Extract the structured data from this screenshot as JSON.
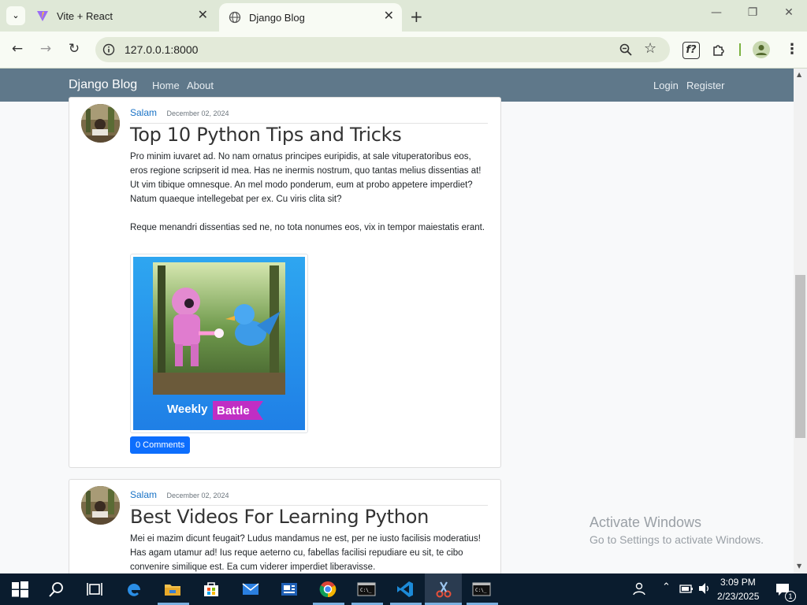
{
  "browser": {
    "tabs": [
      {
        "title": "Vite + React"
      },
      {
        "title": "Django Blog"
      }
    ],
    "url": "127.0.0.1:8000"
  },
  "navbar": {
    "brand": "Django Blog",
    "links": [
      "Home",
      "About"
    ],
    "right_links": [
      "Login",
      "Register"
    ]
  },
  "posts": [
    {
      "author": "Salam",
      "date": "December 02, 2024",
      "title": "Top 10 Python Tips and Tricks",
      "paragraphs": [
        "Pro minim iuvaret ad. No nam ornatus principes euripidis, at sale vituperatoribus eos, eros regione scripserit id mea. Has ne inermis nostrum, quo tantas melius dissentias at! Ut vim tibique omnesque. An mel modo ponderum, eum at probo appetere imperdiet? Natum quaeque intellegebat per ex. Cu viris clita sit?",
        "Reque menandri dissentias sed ne, no tota nonumes eos, vix in tempor maiestatis erant."
      ],
      "image_caption": [
        "Weekly",
        "Battle"
      ],
      "comments_label": "0 Comments"
    },
    {
      "author": "Salam",
      "date": "December 02, 2024",
      "title": "Best Videos For Learning Python",
      "paragraphs": [
        "Mei ei mazim dicunt feugait? Ludus mandamus ne est, per ne iusto facilisis moderatius! Has agam utamur ad! Ius reque aeterno cu, fabellas facilisi repudiare eu sit, te cibo convenire similique est. Ea cum viderer imperdiet liberavisse."
      ]
    }
  ],
  "watermark": {
    "title": "Activate Windows",
    "subtitle": "Go to Settings to activate Windows."
  },
  "taskbar": {
    "time": "3:09 PM",
    "date": "2/23/2025",
    "notification_count": "1"
  }
}
